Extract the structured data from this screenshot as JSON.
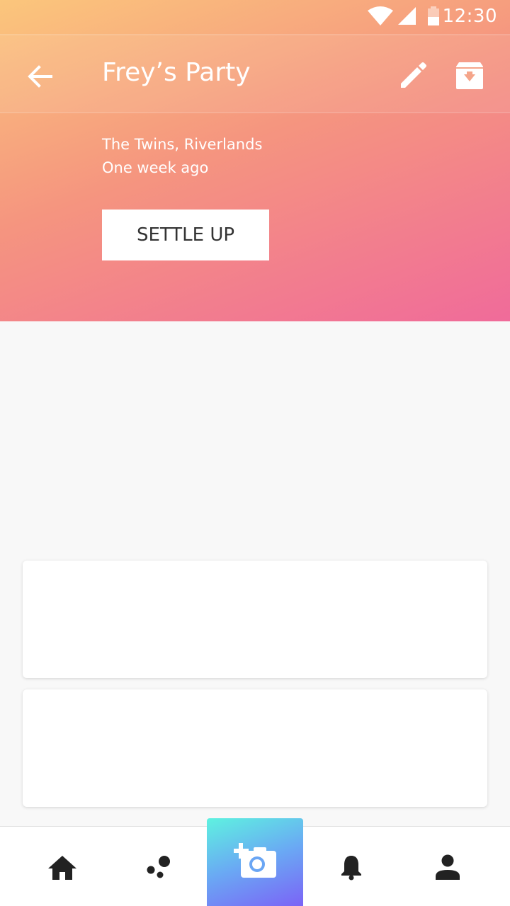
{
  "status_bar": {
    "time": "12:30",
    "icons": [
      "wifi-icon",
      "cellular-signal-icon",
      "battery-icon"
    ]
  },
  "toolbar": {
    "title": "Frey’s Party",
    "back_icon": "arrow-back-icon",
    "actions": [
      "edit-pencil-icon",
      "archive-icon"
    ]
  },
  "event": {
    "location": "The Twins, Riverlands",
    "time_ago": "One week ago",
    "settle_label": "SETTLE UP"
  },
  "bottom_nav": {
    "items": [
      "home-icon",
      "groups-icon",
      "add-photo-icon",
      "notifications-icon",
      "profile-icon"
    ]
  },
  "colors": {
    "header_gradient_start": "#fbc67c",
    "header_gradient_end": "#f06b9a",
    "camera_gradient_start": "#5ef2e0",
    "camera_gradient_end": "#7b63f6"
  }
}
